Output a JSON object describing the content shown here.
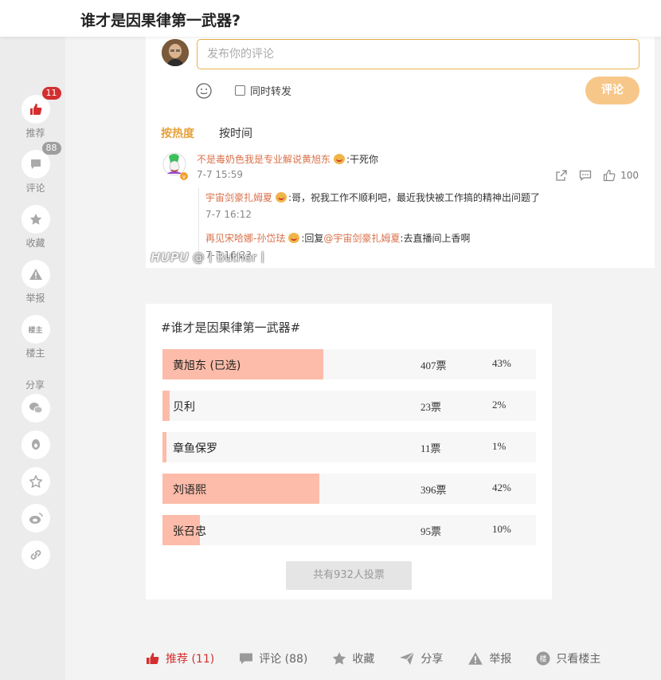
{
  "header": {
    "title": "谁才是因果律第一武器?"
  },
  "sidebar": {
    "recommend": {
      "label": "推荐",
      "badge": "11",
      "icon": "thumbs-up-icon"
    },
    "comment": {
      "label": "评论",
      "badge": "88",
      "icon": "comment-icon"
    },
    "favorite": {
      "label": "收藏",
      "icon": "star-icon"
    },
    "report": {
      "label": "举报",
      "icon": "warning-icon"
    },
    "op": {
      "label": "楼主",
      "icon_text": "楼主"
    },
    "share_label": "分享",
    "share_icons": [
      "wechat-icon",
      "qzone-icon",
      "favorite-star-icon",
      "weibo-icon",
      "link-icon"
    ]
  },
  "comment_box": {
    "placeholder": "发布你的评论",
    "repost_label": "同时转发",
    "submit_label": "评论"
  },
  "sort": {
    "hot": "按热度",
    "time": "按时间"
  },
  "top_comment": {
    "user": "不是毒奶色我是专业解说黄旭东",
    "text": ":干死你",
    "time": "7-7 15:59",
    "likes": "100",
    "replies": [
      {
        "user": "宇宙剑豪扎姆夏",
        "text": ":哥，祝我工作不顺利吧，最近我快被工作搞的精神出问题了",
        "time": "7-7 16:12"
      },
      {
        "user": "再见宋哈娜-孙岱珐",
        "reply_word": ":回复",
        "at": "@宇宙剑豪扎姆夏",
        "text": ":去直播间上香啊",
        "time": "7-7 16:23"
      }
    ]
  },
  "watermark": {
    "brand": "HUPU",
    "user": "@丨Buther丨"
  },
  "poll": {
    "title": "#谁才是因果律第一武器#",
    "options": [
      {
        "label": "黄旭东 (已选)",
        "votes": "407票",
        "percent": "43%",
        "share": 0.43
      },
      {
        "label": "贝利",
        "votes": "23票",
        "percent": "2%",
        "share": 0.02
      },
      {
        "label": "章鱼保罗",
        "votes": "11票",
        "percent": "1%",
        "share": 0.01
      },
      {
        "label": "刘语熙",
        "votes": "396票",
        "percent": "42%",
        "share": 0.42
      },
      {
        "label": "张召忠",
        "votes": "95票",
        "percent": "10%",
        "share": 0.1
      }
    ],
    "total": "共有932人投票"
  },
  "bottom_bar": {
    "recommend": "推荐 (11)",
    "comment": "评论 (88)",
    "favorite": "收藏",
    "share": "分享",
    "report": "举报",
    "op_only": "只看楼主"
  },
  "colors": {
    "accent": "#d32f2f",
    "highlight": "#e8a13c",
    "bar": "#fcbca9",
    "username": "#d9714a"
  }
}
